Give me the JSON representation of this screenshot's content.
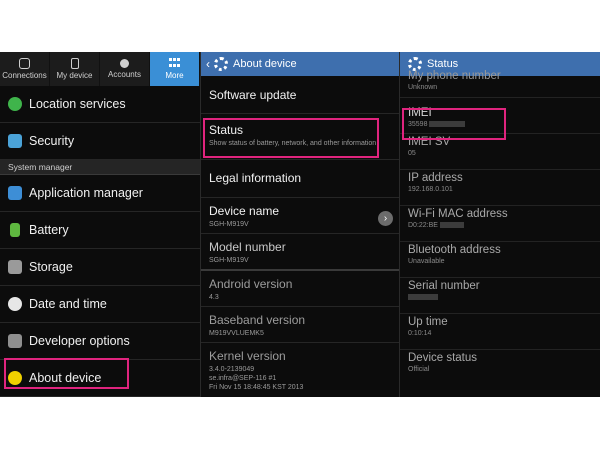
{
  "panel1": {
    "tabs": [
      {
        "label": "Connections",
        "icon": "connections-icon"
      },
      {
        "label": "My device",
        "icon": "phone-icon"
      },
      {
        "label": "Accounts",
        "icon": "key-icon"
      },
      {
        "label": "More",
        "icon": "grid-icon",
        "active": true
      }
    ],
    "items_top": [
      {
        "label": "Location services",
        "icon": "location-icon",
        "color": "#3fb44b"
      },
      {
        "label": "Security",
        "icon": "lock-icon",
        "color": "#4ba3d8"
      }
    ],
    "section": "System manager",
    "items": [
      {
        "label": "Application manager",
        "icon": "apps-icon",
        "color": "#3d8ed6"
      },
      {
        "label": "Battery",
        "icon": "battery-icon",
        "color": "#5fb840"
      },
      {
        "label": "Storage",
        "icon": "storage-icon",
        "color": "#9a9a9a"
      },
      {
        "label": "Date and time",
        "icon": "clock-icon",
        "color": "#e6e6e6"
      },
      {
        "label": "Developer options",
        "icon": "developer-icon",
        "color": "#8f8f8f"
      },
      {
        "label": "About device",
        "icon": "info-icon",
        "color": "#f0d100"
      }
    ]
  },
  "panel2": {
    "header": "About device",
    "items": [
      {
        "title": "Software update",
        "sub": ""
      },
      {
        "title": "Status",
        "sub": "Show status of battery, network, and other information"
      },
      {
        "title": "Legal information",
        "sub": ""
      },
      {
        "title": "Device name",
        "sub": "SGH-M919V"
      },
      {
        "title": "Model number",
        "sub": "SGH-M919V"
      }
    ],
    "dim_items": [
      {
        "title": "Android version",
        "sub": "4.3"
      },
      {
        "title": "Baseband version",
        "sub": "M919VVLUEMK5"
      },
      {
        "title": "Kernel version",
        "sub1": "3.4.0-2139049",
        "sub2": "se.infra@SEP-116 #1",
        "sub3": "Fri Nov 15 18:48:45 KST 2013"
      }
    ]
  },
  "panel3": {
    "header": "Status",
    "partial_top": {
      "title": "My phone number",
      "sub": "Unknown"
    },
    "imei": {
      "title": "IMEI",
      "sub": "35598"
    },
    "items": [
      {
        "title": "IMEI SV",
        "sub": "05"
      },
      {
        "title": "IP address",
        "sub": "192.168.0.101"
      },
      {
        "title": "Wi-Fi MAC address",
        "sub": "D0:22:BE"
      },
      {
        "title": "Bluetooth address",
        "sub": "Unavailable"
      },
      {
        "title": "Serial number",
        "sub": ""
      },
      {
        "title": "Up time",
        "sub": "0:10:14"
      },
      {
        "title": "Device status",
        "sub": "Official"
      }
    ]
  },
  "colors": {
    "highlight": "#e0247e",
    "header": "#3e6fae",
    "tab_active": "#3a8fd6"
  }
}
